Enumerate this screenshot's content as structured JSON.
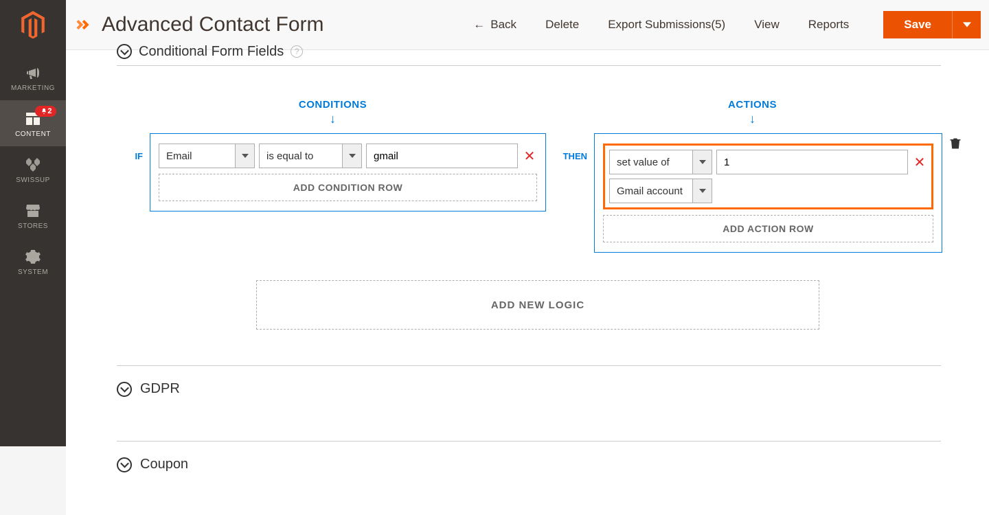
{
  "sidebar": {
    "items": [
      {
        "label": "MARKETING"
      },
      {
        "label": "CONTENT",
        "badge": "2"
      },
      {
        "label": "SWISSUP"
      },
      {
        "label": "STORES"
      },
      {
        "label": "SYSTEM"
      }
    ]
  },
  "topbar": {
    "title": "Advanced Contact Form",
    "back": "Back",
    "delete": "Delete",
    "export": "Export Submissions(5)",
    "view": "View",
    "reports": "Reports",
    "save": "Save"
  },
  "sections": {
    "conditional": "Conditional Form Fields",
    "gdpr": "GDPR",
    "coupon": "Coupon"
  },
  "logic": {
    "conditions_label": "CONDITIONS",
    "actions_label": "ACTIONS",
    "if": "IF",
    "then": "THEN",
    "condition": {
      "field": "Email",
      "operator": "is equal to",
      "value": "gmail"
    },
    "action": {
      "type": "set value of",
      "value": "1",
      "target": "Gmail account"
    },
    "add_condition": "ADD CONDITION ROW",
    "add_action": "ADD ACTION ROW",
    "add_logic": "ADD NEW LOGIC"
  }
}
